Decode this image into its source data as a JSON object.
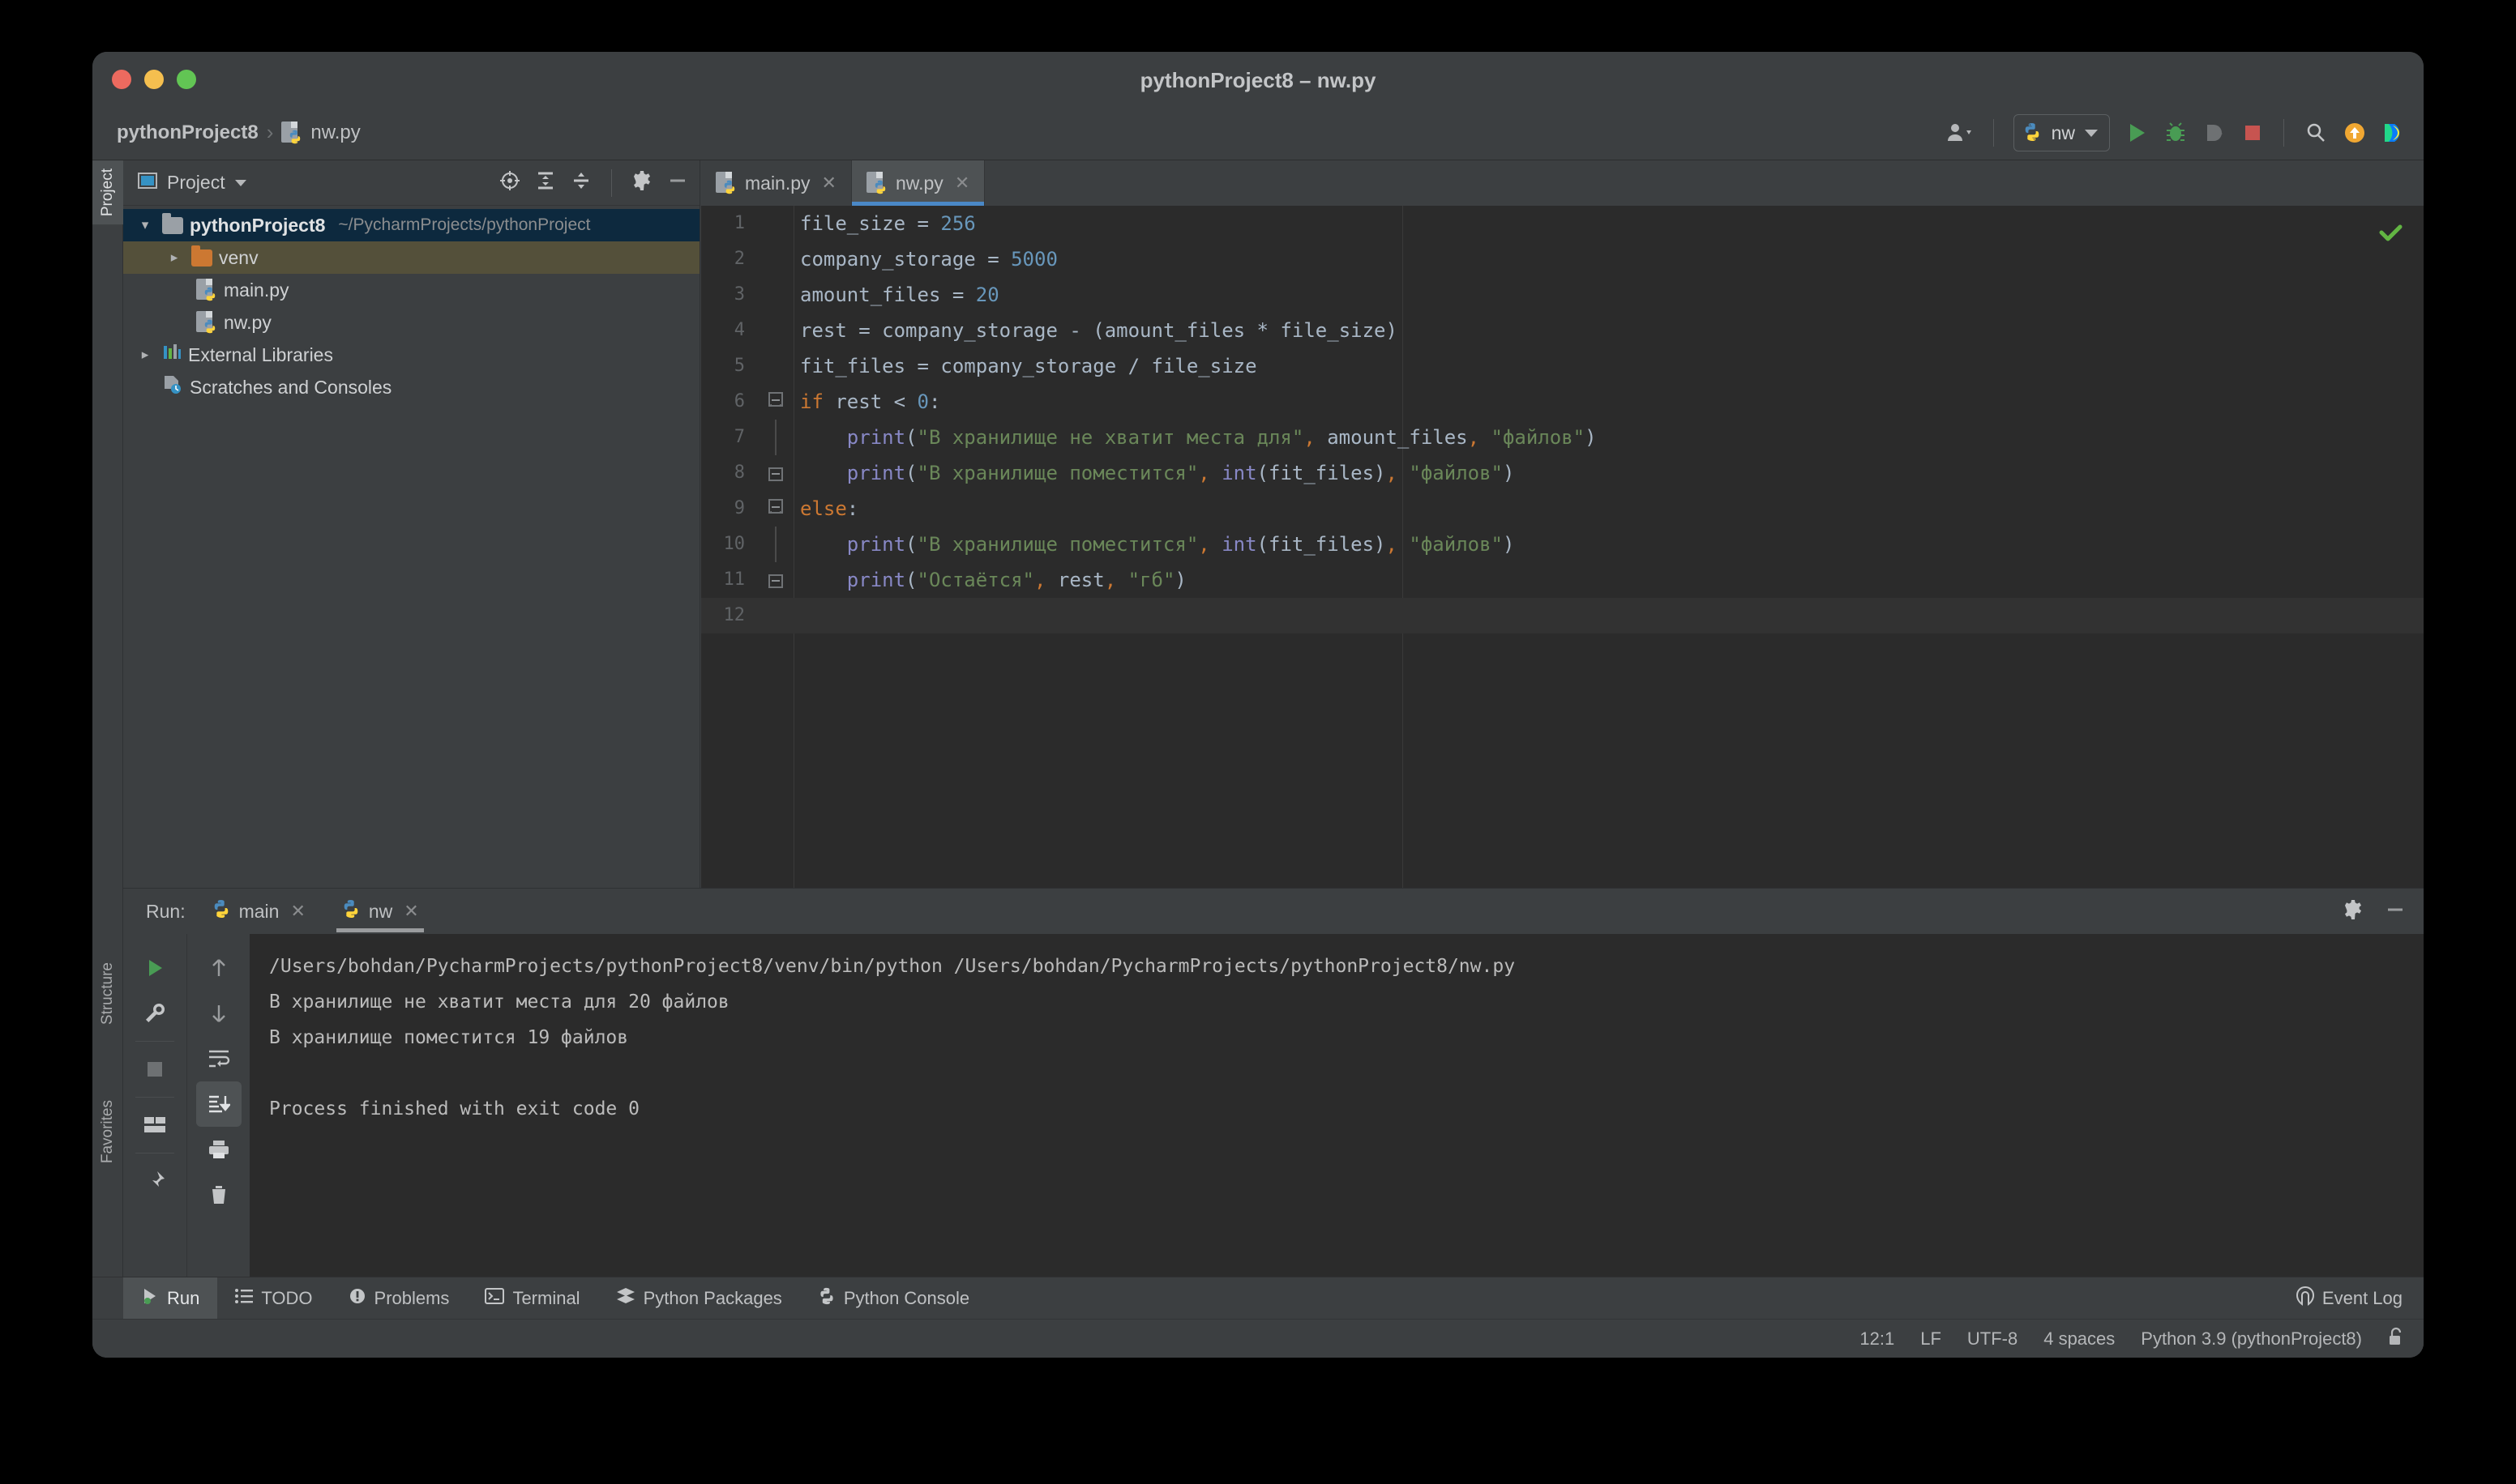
{
  "window": {
    "title": "pythonProject8 – nw.py",
    "traffic_lights": [
      "close",
      "minimize",
      "maximize"
    ]
  },
  "breadcrumb": {
    "project": "pythonProject8",
    "separator": "›",
    "file": "nw.py"
  },
  "toolbar": {
    "account_icon": "user-icon",
    "run_config": {
      "icon": "python-icon",
      "label": "nw"
    },
    "run_icon": "run-icon",
    "debug_icon": "debug-icon",
    "coverage_icon": "run-with-coverage-icon",
    "stop_icon": "stop-icon",
    "search_icon": "search-icon",
    "update_icon": "update-icon",
    "plugin_icon": "jetbrains-toolbox-icon"
  },
  "rail": {
    "project": "Project",
    "structure": "Structure",
    "favorites": "Favorites"
  },
  "project_panel": {
    "title": "Project",
    "tools": [
      "locate-icon",
      "expand-all-icon",
      "collapse-all-icon",
      "settings-icon",
      "hide-icon"
    ],
    "tree": [
      {
        "label": "pythonProject8",
        "path": "~/PycharmProjects/pythonProject",
        "type": "folder",
        "state": "selected",
        "expanded": true,
        "depth": 0
      },
      {
        "label": "venv",
        "path": "",
        "type": "folder-orange",
        "state": "hovered",
        "expanded": false,
        "depth": 1
      },
      {
        "label": "main.py",
        "path": "",
        "type": "python",
        "state": "",
        "expanded": null,
        "depth": 2
      },
      {
        "label": "nw.py",
        "path": "",
        "type": "python",
        "state": "",
        "expanded": null,
        "depth": 2
      },
      {
        "label": "External Libraries",
        "path": "",
        "type": "libraries",
        "state": "",
        "expanded": false,
        "depth": 0
      },
      {
        "label": "Scratches and Consoles",
        "path": "",
        "type": "scratches",
        "state": "",
        "expanded": null,
        "depth": 0
      }
    ]
  },
  "editor": {
    "tabs": [
      {
        "label": "main.py",
        "active": false
      },
      {
        "label": "nw.py",
        "active": true
      }
    ],
    "inspection_status": "ok-check-icon",
    "lines": [
      {
        "n": "1",
        "fold": "none"
      },
      {
        "n": "2",
        "fold": "none"
      },
      {
        "n": "3",
        "fold": "none"
      },
      {
        "n": "4",
        "fold": "none"
      },
      {
        "n": "5",
        "fold": "none"
      },
      {
        "n": "6",
        "fold": "start"
      },
      {
        "n": "7",
        "fold": "none"
      },
      {
        "n": "8",
        "fold": "end"
      },
      {
        "n": "9",
        "fold": "start"
      },
      {
        "n": "10",
        "fold": "none"
      },
      {
        "n": "11",
        "fold": "end"
      },
      {
        "n": "12",
        "fold": "none"
      }
    ],
    "code_plain": [
      "file_size = 256",
      "company_storage = 5000",
      "amount_files = 20",
      "rest = company_storage - (amount_files * file_size)",
      "fit_files = company_storage / file_size",
      "if rest < 0:",
      "    print(\"В хранилище не хватит места для\", amount_files, \"файлов\")",
      "    print(\"В хранилище поместится\", int(fit_files), \"файлов\")",
      "else:",
      "    print(\"В хранилище поместится\", int(fit_files), \"файлов\")",
      "    print(\"Остаётся\", rest, \"гб\")",
      ""
    ]
  },
  "run_panel": {
    "label": "Run:",
    "tabs": [
      {
        "label": "main",
        "active": false
      },
      {
        "label": "nw",
        "active": true
      }
    ],
    "settings_icon": "settings-icon",
    "hide_icon": "hide-icon",
    "tools_left": [
      "rerun-icon",
      "wrench-icon",
      "stop-icon",
      "layout-icon",
      "pin-icon"
    ],
    "tools_right": [
      "up-icon",
      "down-icon",
      "soft-wrap-icon",
      "scroll-to-end-icon",
      "print-icon",
      "trash-icon"
    ],
    "console_lines": [
      "/Users/bohdan/PycharmProjects/pythonProject8/venv/bin/python /Users/bohdan/PycharmProjects/pythonProject8/nw.py",
      "В хранилище не хватит места для 20 файлов",
      "В хранилище поместится 19 файлов",
      "",
      "Process finished with exit code 0"
    ]
  },
  "bottom_toolbar": {
    "items": [
      {
        "label": "Run",
        "icon": "run-icon",
        "active": true
      },
      {
        "label": "TODO",
        "icon": "todo-icon",
        "active": false
      },
      {
        "label": "Problems",
        "icon": "problems-icon",
        "active": false
      },
      {
        "label": "Terminal",
        "icon": "terminal-icon",
        "active": false
      },
      {
        "label": "Python Packages",
        "icon": "packages-icon",
        "active": false
      },
      {
        "label": "Python Console",
        "icon": "python-icon",
        "active": false
      }
    ],
    "event_log": {
      "label": "Event Log",
      "icon": "event-log-icon"
    }
  },
  "status_bar": {
    "caret": "12:1",
    "line_ending": "LF",
    "encoding": "UTF-8",
    "indent": "4 spaces",
    "interpreter": "Python 3.9 (pythonProject8)",
    "lock_icon": "unlocked-icon"
  },
  "colors": {
    "accent_blue": "#4a88c7",
    "selection_blue": "#0d293e",
    "hover_olive": "#54503a",
    "editor_bg": "#2b2b2b",
    "chrome_bg": "#3c3f41",
    "string_green": "#6a8759",
    "keyword_orange": "#cc7832",
    "number_blue": "#6897bb",
    "function_purple": "#8888c6",
    "run_green": "#499c54",
    "stop_red": "#c75450"
  }
}
